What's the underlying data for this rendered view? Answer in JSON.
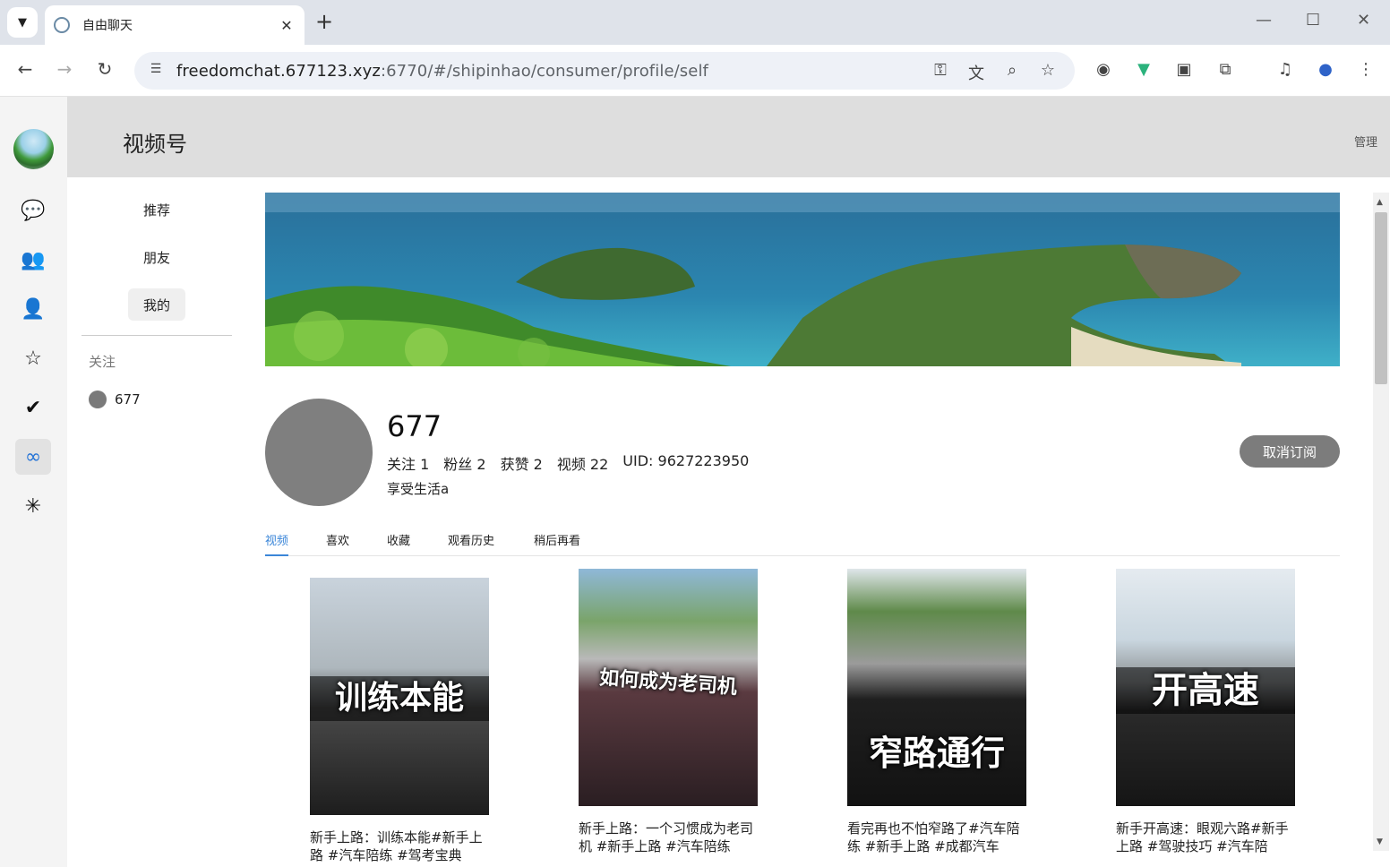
{
  "browser": {
    "tab_title": "自由聊天",
    "url_host": "freedomchat.677123.xyz",
    "url_rest": ":6770/#/shipinhao/consumer/profile/self"
  },
  "header": {
    "title": "视频号",
    "manage": "管理"
  },
  "nav": {
    "items": [
      {
        "label": "推荐"
      },
      {
        "label": "朋友"
      },
      {
        "label": "我的"
      }
    ],
    "follow_heading": "关注",
    "follows": [
      {
        "name": "677"
      }
    ]
  },
  "profile": {
    "name": "677",
    "stats": {
      "following": "关注 1",
      "fans": "粉丝 2",
      "likes": "获赞 2",
      "videos": "视频 22",
      "uid": "UID: 9627223950"
    },
    "bio": "享受生活a",
    "unsubscribe": "取消订阅"
  },
  "tabs": [
    "视频",
    "喜欢",
    "收藏",
    "观看历史",
    "稍后再看"
  ],
  "videos": [
    {
      "caption": "训练本能",
      "title": "新手上路：训练本能#新手上路 #汽车陪练 #驾考宝典"
    },
    {
      "caption": "如何成为老司机",
      "title": "新手上路：一个习惯成为老司机 #新手上路 #汽车陪练"
    },
    {
      "caption": "窄路通行",
      "title": "看完再也不怕窄路了#汽车陪练 #新手上路 #成都汽车"
    },
    {
      "caption": "开高速",
      "title": "新手开高速：眼观六路#新手上路 #驾驶技巧 #汽车陪"
    }
  ],
  "colors": {
    "accent": "#3b86d8",
    "header_bg": "#dedede",
    "rail_bg": "#f4f4f4"
  }
}
